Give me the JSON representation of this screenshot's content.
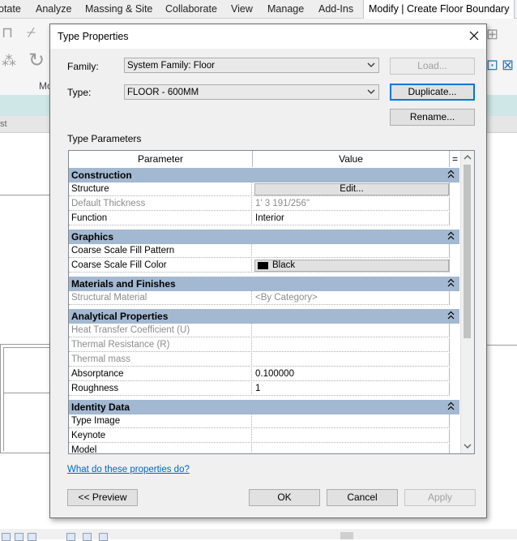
{
  "background": {
    "ribbon_tabs": [
      "otate",
      "Analyze",
      "Massing & Site",
      "Collaborate",
      "View",
      "Manage",
      "Add-Ins",
      "Modify | Create Floor Boundary"
    ],
    "side_fragment": "st",
    "ribbon_fragment": "Mo"
  },
  "dialog": {
    "title": "Type Properties",
    "family_label": "Family:",
    "family_value": "System Family: Floor",
    "type_label": "Type:",
    "type_value": "FLOOR - 600MM",
    "load_button": "Load...",
    "duplicate_button": "Duplicate...",
    "rename_button": "Rename...",
    "type_parameters_label": "Type Parameters",
    "grid": {
      "col_parameter": "Parameter",
      "col_value": "Value",
      "col_sort": "=",
      "sections": [
        {
          "title": "Construction",
          "rows": [
            {
              "name": "Structure",
              "value": "Edit...",
              "kind": "button"
            },
            {
              "name": "Default Thickness",
              "value": "1'  3 191/256\"",
              "kind": "disabled"
            },
            {
              "name": "Function",
              "value": "Interior",
              "kind": "text"
            }
          ]
        },
        {
          "title": "Graphics",
          "rows": [
            {
              "name": "Coarse Scale Fill Pattern",
              "value": "",
              "kind": "text"
            },
            {
              "name": "Coarse Scale Fill Color",
              "value": "Black",
              "kind": "color"
            }
          ]
        },
        {
          "title": "Materials and Finishes",
          "rows": [
            {
              "name": "Structural Material",
              "value": "<By Category>",
              "kind": "disabled"
            }
          ]
        },
        {
          "title": "Analytical Properties",
          "rows": [
            {
              "name": "Heat Transfer Coefficient (U)",
              "value": "",
              "kind": "disabled"
            },
            {
              "name": "Thermal Resistance (R)",
              "value": "",
              "kind": "disabled"
            },
            {
              "name": "Thermal mass",
              "value": "",
              "kind": "disabled"
            },
            {
              "name": "Absorptance",
              "value": "0.100000",
              "kind": "text"
            },
            {
              "name": "Roughness",
              "value": "1",
              "kind": "text"
            }
          ]
        },
        {
          "title": "Identity Data",
          "rows": [
            {
              "name": "Type Image",
              "value": "",
              "kind": "text"
            },
            {
              "name": "Keynote",
              "value": "",
              "kind": "text"
            },
            {
              "name": "Model",
              "value": "",
              "kind": "text"
            }
          ]
        }
      ]
    },
    "help_link": "What do these properties do?",
    "preview_button": "<< Preview",
    "ok_button": "OK",
    "cancel_button": "Cancel",
    "apply_button": "Apply"
  },
  "colors": {
    "section_header": "#a3b8d1",
    "active_tab": "#ffffff",
    "default_button_border": "#0078d7",
    "link": "#0066cc",
    "fill_color_swatch": "#000000"
  }
}
